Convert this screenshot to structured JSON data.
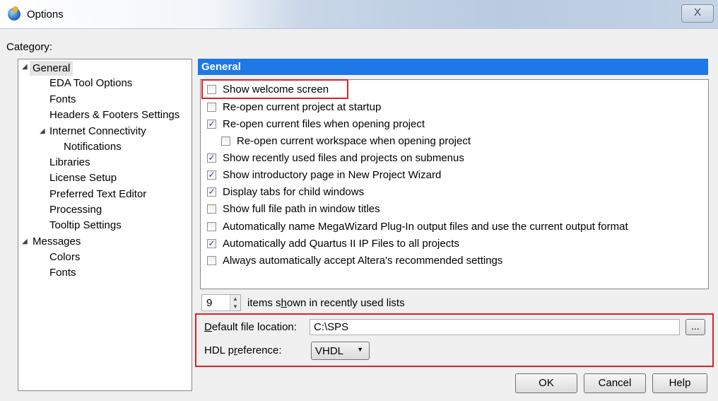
{
  "window": {
    "title": "Options",
    "close_glyph": "X"
  },
  "category_label": "Category:",
  "tree": {
    "general": "General",
    "eda_tool_options": "EDA Tool Options",
    "fonts": "Fonts",
    "headers_footers": "Headers & Footers Settings",
    "internet_connectivity": "Internet Connectivity",
    "notifications": "Notifications",
    "libraries": "Libraries",
    "license_setup": "License Setup",
    "preferred_text_editor": "Preferred Text Editor",
    "processing": "Processing",
    "tooltip_settings": "Tooltip Settings",
    "messages": "Messages",
    "colors": "Colors",
    "messages_fonts": "Fonts",
    "expand_glyph": "◢"
  },
  "panel": {
    "title": "General"
  },
  "options": [
    {
      "label": "Show welcome screen",
      "checked": false
    },
    {
      "label": "Re-open current project at startup",
      "checked": false
    },
    {
      "label": "Re-open current files when opening project",
      "checked": true
    },
    {
      "label": "Re-open current workspace when opening project",
      "checked": false
    },
    {
      "label": "Show recently used files and projects on submenus",
      "checked": true
    },
    {
      "label": "Show introductory page in New Project Wizard",
      "checked": true
    },
    {
      "label": "Display tabs for child windows",
      "checked": true
    },
    {
      "label": "Show full file path in window titles",
      "checked": false
    },
    {
      "label": "Automatically name MegaWizard Plug-In output files and use the current output format",
      "checked": false
    },
    {
      "label": "Automatically add Quartus II IP Files to all projects",
      "checked": true
    },
    {
      "label": "Always automatically accept Altera's recommended settings",
      "checked": false
    }
  ],
  "recent": {
    "value": "9",
    "label_pre": "items s",
    "label_underline": "h",
    "label_post": "own in recently used lists"
  },
  "default_file_location": {
    "label_underline": "D",
    "label_rest": "efault file location:",
    "value": "C:\\SPS",
    "browse_label": "..."
  },
  "hdl_preference": {
    "label_pre": "HDL p",
    "label_underline": "r",
    "label_post": "eference:",
    "value": "VHDL"
  },
  "buttons": {
    "ok": "OK",
    "cancel": "Cancel",
    "help": "Help"
  },
  "colors": {
    "header_blue": "#1e78e6",
    "highlight_red": "#e0202a"
  }
}
